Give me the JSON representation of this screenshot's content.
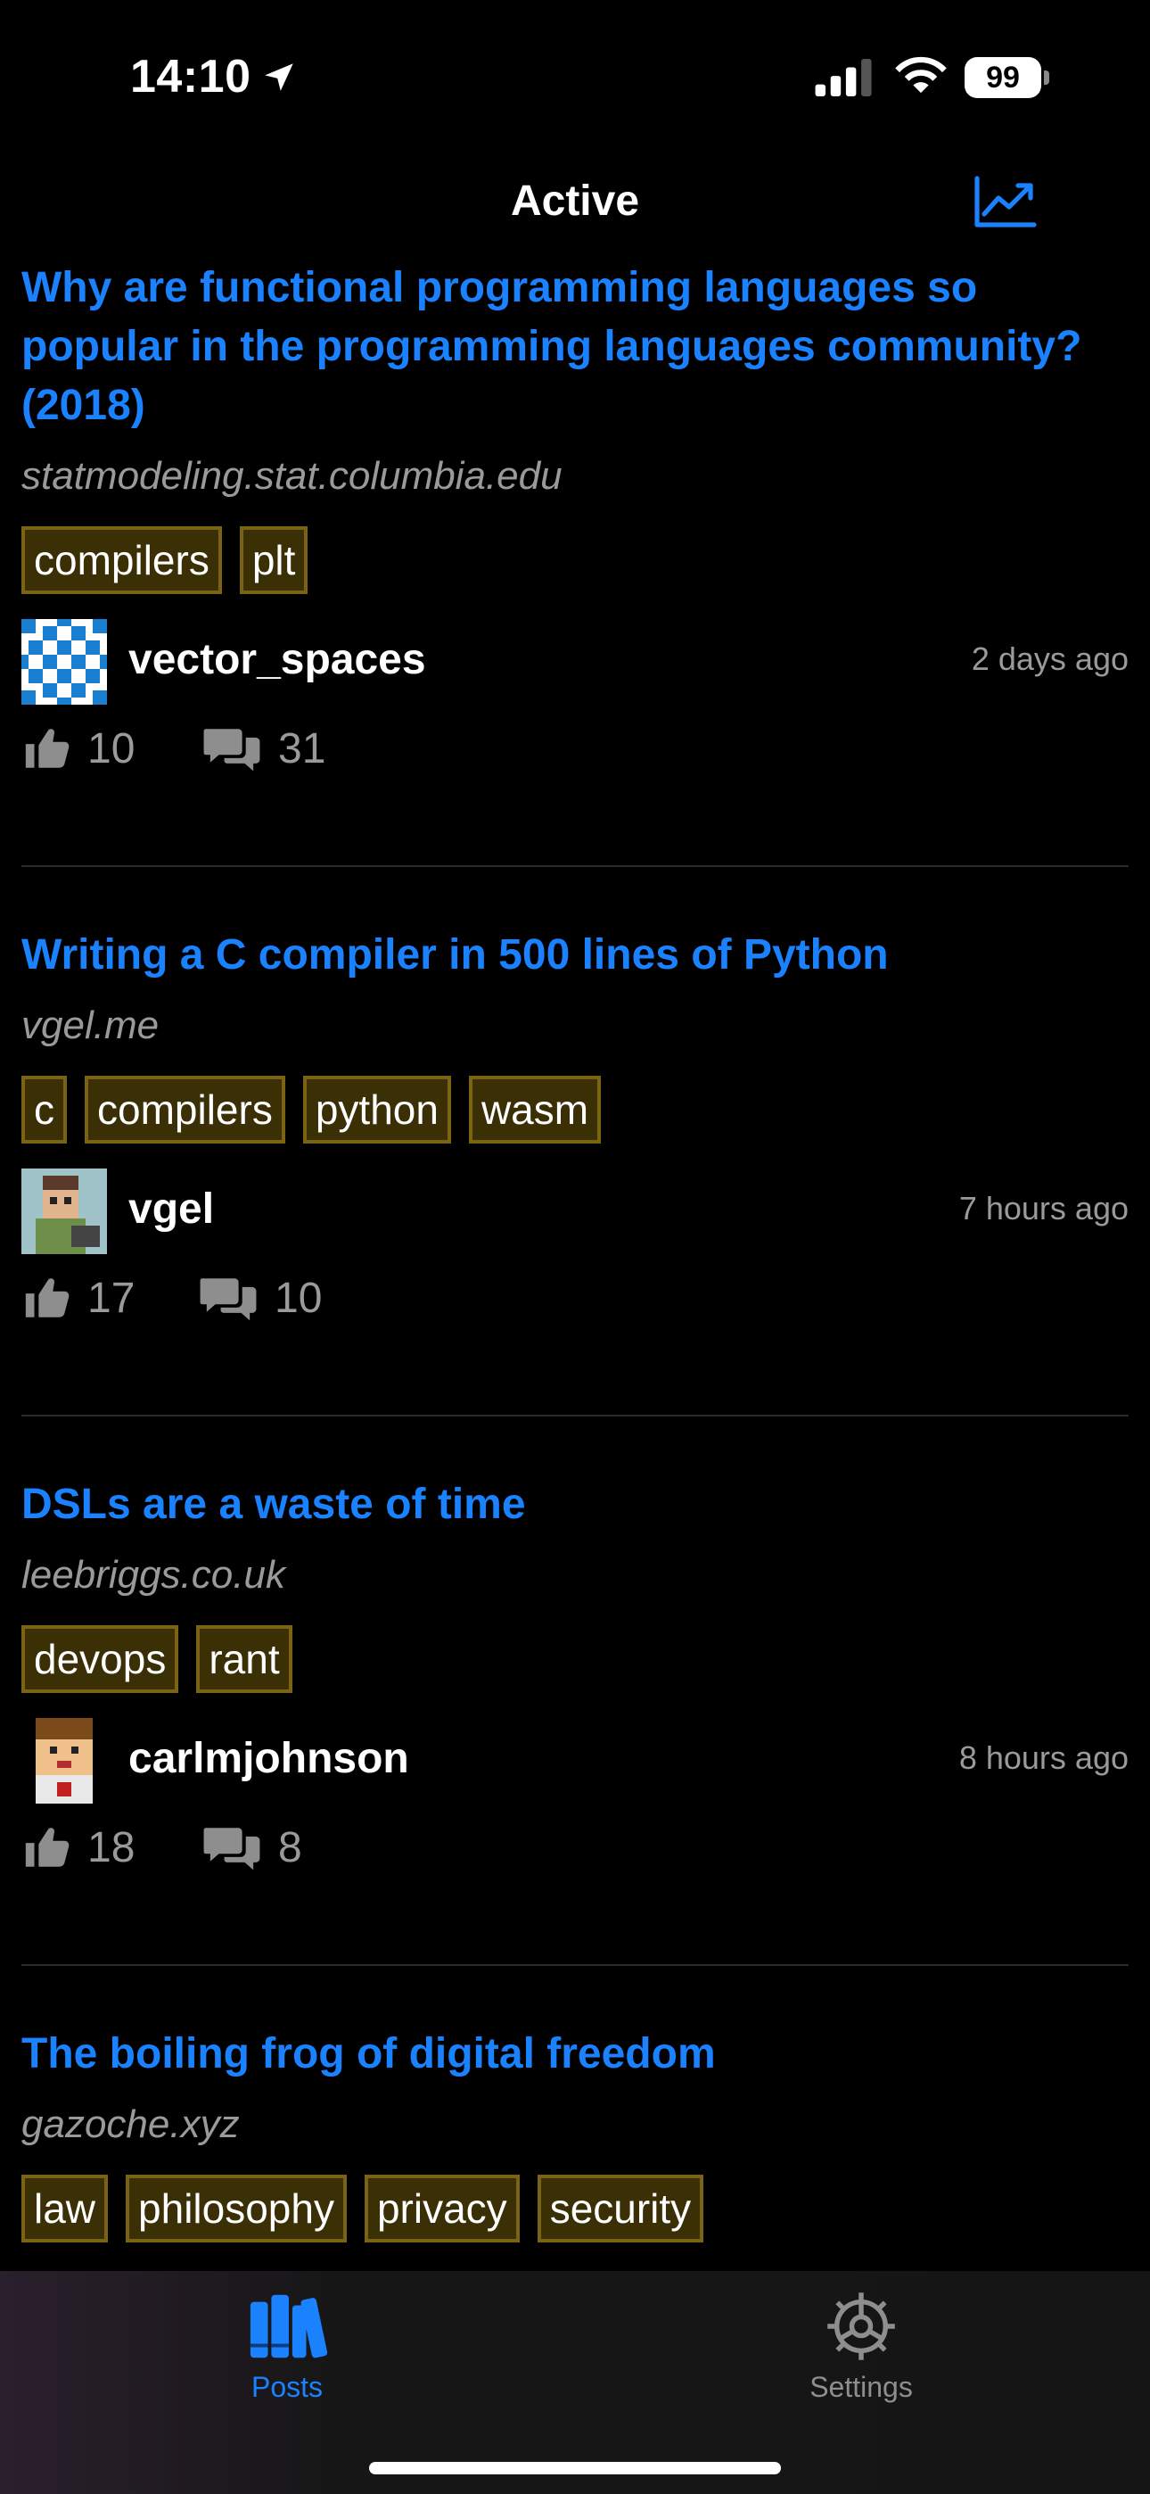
{
  "status_bar": {
    "time": "14:10",
    "battery": "99"
  },
  "nav": {
    "title": "Active",
    "action_icon": "chart-line-icon"
  },
  "colors": {
    "accent": "#1a82ff",
    "tag_border": "#7a6414",
    "tag_bg": "#3b2f06"
  },
  "posts": [
    {
      "title": "Why are functional programming languages so popular in the programming languages community? (2018)",
      "domain": "statmodeling.stat.columbia.edu",
      "tags": [
        "compilers",
        "plt"
      ],
      "author": "vector_spaces",
      "time": "2 days ago",
      "likes": "10",
      "comments": "31"
    },
    {
      "title": "Writing a C compiler in 500 lines of Python",
      "domain": "vgel.me",
      "tags": [
        "c",
        "compilers",
        "python",
        "wasm"
      ],
      "author": "vgel",
      "time": "7 hours ago",
      "likes": "17",
      "comments": "10"
    },
    {
      "title": "DSLs are a waste of time",
      "domain": "leebriggs.co.uk",
      "tags": [
        "devops",
        "rant"
      ],
      "author": "carlmjohnson",
      "time": "8 hours ago",
      "likes": "18",
      "comments": "8"
    },
    {
      "title": "The boiling frog of digital freedom",
      "domain": "gazoche.xyz",
      "tags": [
        "law",
        "philosophy",
        "privacy",
        "security"
      ]
    }
  ],
  "tab_bar": {
    "posts_label": "Posts",
    "settings_label": "Settings"
  }
}
